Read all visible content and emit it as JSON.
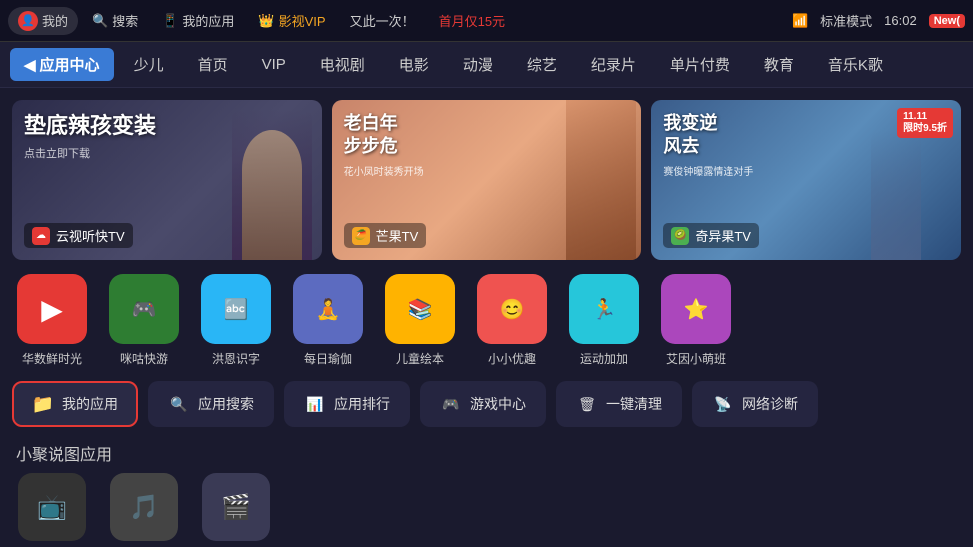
{
  "topbar": {
    "items": [
      {
        "id": "my",
        "label": "我的",
        "icon": "👤",
        "color": "#e53935",
        "active": false
      },
      {
        "id": "search",
        "label": "搜索",
        "icon": "🔍",
        "color": "#555",
        "active": false
      },
      {
        "id": "myapps",
        "label": "我的应用",
        "icon": "📱",
        "color": "#555",
        "active": false
      },
      {
        "id": "vip",
        "label": "影视VIP",
        "icon": "👑",
        "color": "#f5a623",
        "active": false
      },
      {
        "id": "promo",
        "label": "又此一次！",
        "icon": "",
        "color": "#555",
        "active": false
      },
      {
        "id": "first",
        "label": "首月仅15元",
        "icon": "",
        "color": "#e53935",
        "active": false
      }
    ],
    "right": {
      "mode": "标准模式",
      "time": "16:02",
      "new_label": "New(",
      "wifi_icon": "📶"
    }
  },
  "navbar": {
    "back_label": "应用中心",
    "items": [
      "少儿",
      "首页",
      "VIP",
      "电视剧",
      "电影",
      "动漫",
      "综艺",
      "纪录片",
      "单片付费",
      "教育",
      "音乐K歌"
    ]
  },
  "banners": [
    {
      "id": "banner1",
      "title": "垫底辣孩变装",
      "subtitle": "点击立即下载",
      "label": "云视听快TV",
      "label_icon": "☁️",
      "label_color": "#e53935",
      "bg_class": "banner-1"
    },
    {
      "id": "banner2",
      "title": "老白年\n步步危",
      "subtitle": "花小凤时装秀开场",
      "label": "芒果TV",
      "label_icon": "🥭",
      "label_color": "#f5a623",
      "bg_class": "banner-2"
    },
    {
      "id": "banner3",
      "title": "我变逆\n风去",
      "subtitle": "赛俊钟曝露情逢对手",
      "label": "奇异果TV",
      "label_icon": "🥝",
      "label_color": "#4caf50",
      "bg_class": "banner-3"
    }
  ],
  "apps": [
    {
      "id": "huashu",
      "name": "华数鲜时光",
      "icon": "▶",
      "bg": "#e53935"
    },
    {
      "id": "miaoku",
      "name": "咪咕快游",
      "icon": "🎮",
      "bg": "#4caf50"
    },
    {
      "id": "hongsi",
      "name": "洪恩识字",
      "icon": "🔤",
      "bg": "#29b6f6"
    },
    {
      "id": "yoga",
      "name": "每日瑜伽",
      "icon": "🧘",
      "bg": "#5c6bc0"
    },
    {
      "id": "picture",
      "name": "儿童绘本",
      "icon": "📚",
      "bg": "#ffb300"
    },
    {
      "id": "xiaoxiao",
      "name": "小小优趣",
      "icon": "😊",
      "bg": "#ef5350"
    },
    {
      "id": "sport",
      "name": "运动加加",
      "icon": "🏃",
      "bg": "#26c6da"
    },
    {
      "id": "ayin",
      "name": "艾因小萌班",
      "icon": "⭐",
      "bg": "#ab47bc"
    }
  ],
  "tools": [
    {
      "id": "myapps",
      "label": "我的应用",
      "icon": "📁",
      "icon_color": "#4caf50",
      "highlighted": true
    },
    {
      "id": "appsearch",
      "label": "应用搜索",
      "icon": "🔍",
      "icon_color": "#555",
      "highlighted": false
    },
    {
      "id": "apprank",
      "label": "应用排行",
      "icon": "📊",
      "icon_color": "#555",
      "highlighted": false
    },
    {
      "id": "gamecenter",
      "label": "游戏中心",
      "icon": "🎮",
      "icon_color": "#555",
      "highlighted": false
    },
    {
      "id": "oneclean",
      "label": "一键清理",
      "icon": "🗑",
      "icon_color": "#555",
      "highlighted": false
    },
    {
      "id": "netdiag",
      "label": "网络诊断",
      "icon": "📡",
      "icon_color": "#555",
      "highlighted": false
    }
  ],
  "section": {
    "title": "小聚说图应用"
  },
  "bottom_apps": [
    {
      "id": "b1",
      "name": "",
      "icon": "📺",
      "bg": "#333"
    },
    {
      "id": "b2",
      "name": "",
      "icon": "🎵",
      "bg": "#333"
    },
    {
      "id": "b3",
      "name": "",
      "icon": "🎬",
      "bg": "#333"
    }
  ]
}
